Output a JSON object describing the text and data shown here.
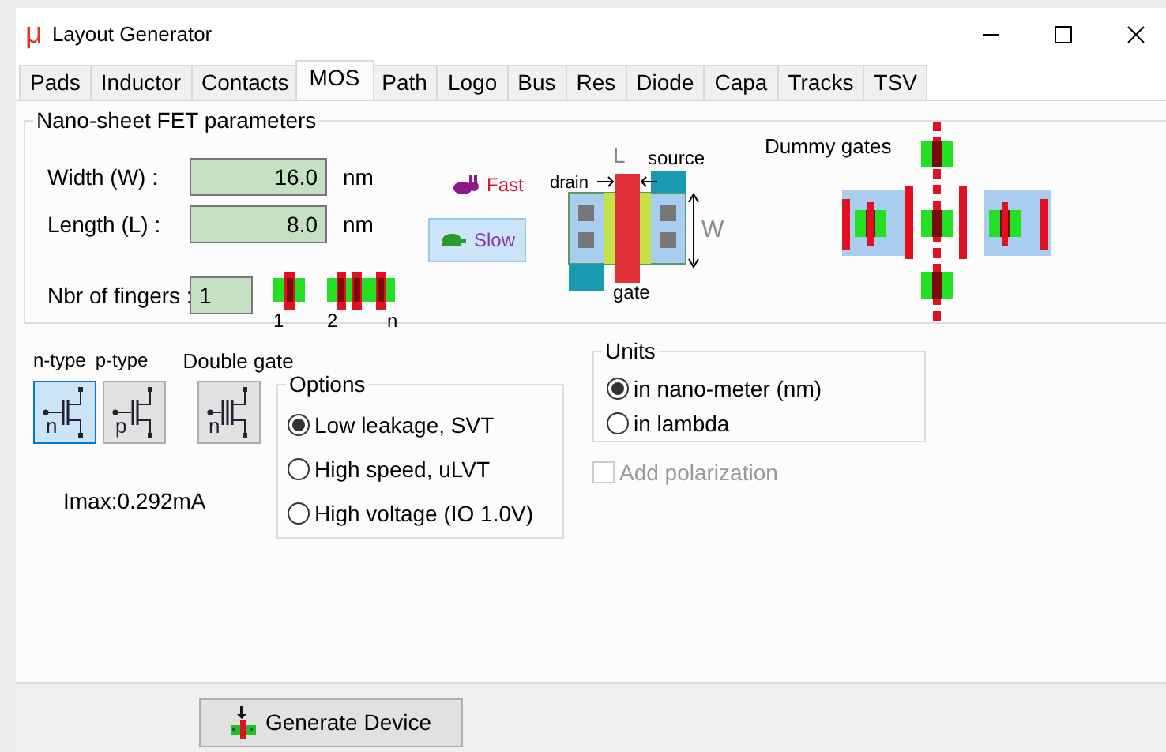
{
  "window": {
    "logo": "μ",
    "title": "Layout Generator"
  },
  "tabs": [
    {
      "label": "Pads",
      "selected": false
    },
    {
      "label": "Inductor",
      "selected": false
    },
    {
      "label": "Contacts",
      "selected": false
    },
    {
      "label": "MOS",
      "selected": true
    },
    {
      "label": "Path",
      "selected": false
    },
    {
      "label": "Logo",
      "selected": false
    },
    {
      "label": "Bus",
      "selected": false
    },
    {
      "label": "Res",
      "selected": false
    },
    {
      "label": "Diode",
      "selected": false
    },
    {
      "label": "Capa",
      "selected": false
    },
    {
      "label": "Tracks",
      "selected": false
    },
    {
      "label": "TSV",
      "selected": false
    }
  ],
  "parameters": {
    "title": "Nano-sheet FET parameters",
    "fields": [
      {
        "label": "Width (W) :",
        "value": "16.0",
        "unit": "nm"
      },
      {
        "label": "Length (L) :",
        "value": "8.0",
        "unit": "nm"
      }
    ],
    "fingers": {
      "label": "Nbr of fingers :",
      "value": "1",
      "marks": [
        "1",
        "2",
        "n"
      ]
    },
    "speed": [
      {
        "label": "Fast",
        "kind": "rabbit",
        "selected": false
      },
      {
        "label": "Slow",
        "kind": "turtle",
        "selected": true
      }
    ],
    "diagram": {
      "l": "L",
      "source": "source",
      "drain": "drain",
      "w": "W",
      "gate": "gate"
    },
    "dummy_gates": "Dummy gates"
  },
  "device_types": [
    {
      "label": "n-type",
      "symbol": "n",
      "selected": true
    },
    {
      "label": "p-type",
      "symbol": "p",
      "selected": false
    }
  ],
  "double_gate": {
    "label": "Double gate",
    "symbol": "n",
    "selected": false
  },
  "options": {
    "title": "Options",
    "items": [
      {
        "label": "Low leakage, SVT",
        "selected": true
      },
      {
        "label": "High speed, uLVT",
        "selected": false
      },
      {
        "label": "High voltage (IO 1.0V)",
        "selected": false
      }
    ]
  },
  "units": {
    "title": "Units",
    "items": [
      {
        "label": "in nano-meter (nm)",
        "selected": true
      },
      {
        "label": "in lambda",
        "selected": false
      }
    ]
  },
  "add_polarization": {
    "label": "Add polarization",
    "checked": false,
    "disabled": true
  },
  "imax": "Imax:0.292mA",
  "generate_button": "Generate Device"
}
